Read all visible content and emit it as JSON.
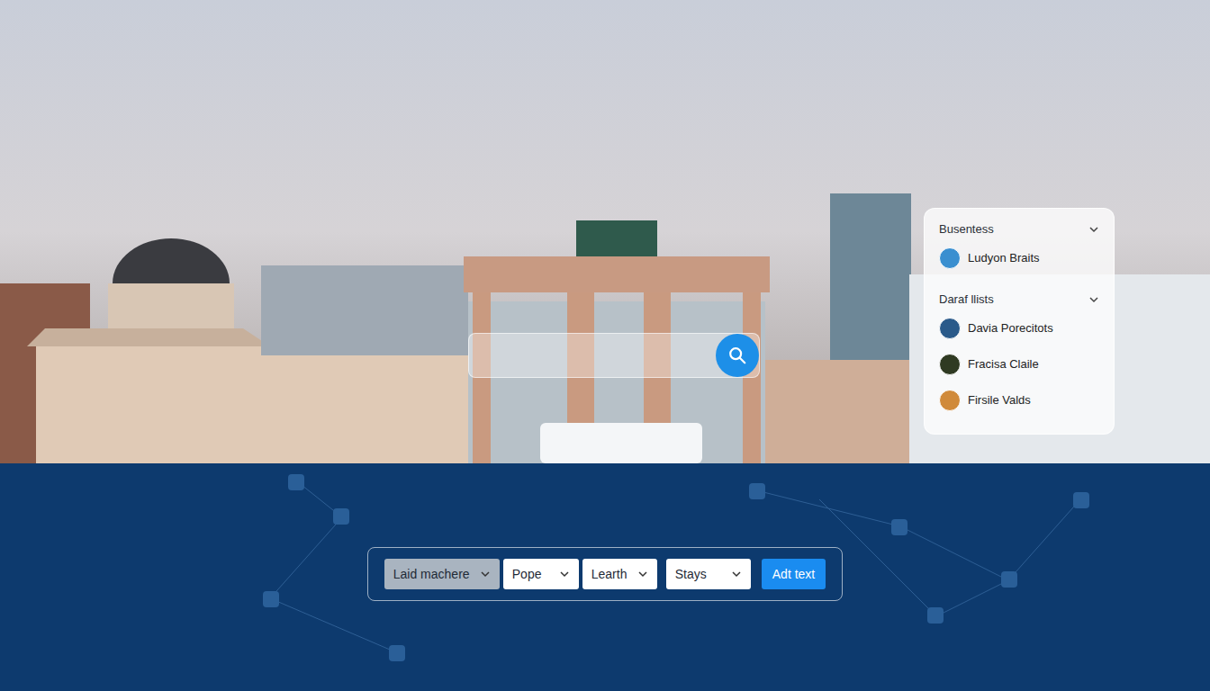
{
  "panel": {
    "sections": [
      {
        "title": "Busentess",
        "expanded": true,
        "items": [
          {
            "name": "Ludyon Braits",
            "color": "#3a8fd0"
          }
        ]
      },
      {
        "title": "Daraf llists",
        "expanded": true,
        "items": [
          {
            "name": "Davia Porecitots",
            "color": "#2a5a8a"
          },
          {
            "name": "Fracisa Claile",
            "color": "#2f3a22"
          },
          {
            "name": "Firsile Valds",
            "color": "#d08a3a"
          }
        ]
      }
    ]
  },
  "filters": [
    {
      "label": "Laid machere",
      "selected": true
    },
    {
      "label": "Pope",
      "selected": false
    },
    {
      "label": "Learth",
      "selected": false
    },
    {
      "label": "Stays",
      "selected": false
    }
  ],
  "action_button": "Adt text"
}
